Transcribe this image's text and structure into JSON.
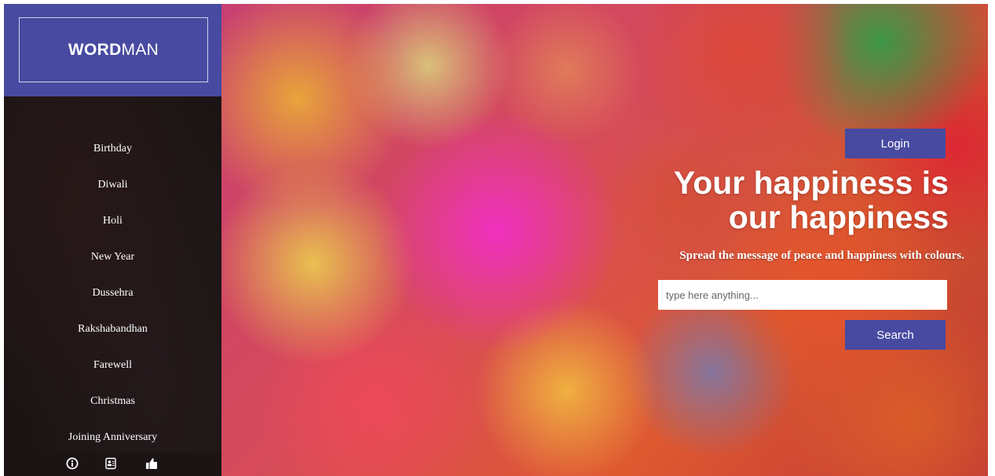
{
  "brand": {
    "bold": "WORD",
    "light": "MAN"
  },
  "nav": {
    "items": [
      {
        "label": "Birthday"
      },
      {
        "label": "Diwali"
      },
      {
        "label": "Holi"
      },
      {
        "label": "New Year"
      },
      {
        "label": "Dussehra"
      },
      {
        "label": "Rakshabandhan"
      },
      {
        "label": "Farewell"
      },
      {
        "label": "Christmas"
      },
      {
        "label": "Joining Anniversary"
      }
    ]
  },
  "footer_icons": [
    "info-icon",
    "contact-card-icon",
    "thumbs-up-icon"
  ],
  "hero": {
    "login_label": "Login",
    "headline_line1": "Your happiness is",
    "headline_line2": "our happiness",
    "tagline": "Spread the message of peace and happiness with colours.",
    "search": {
      "placeholder": "type here anything...",
      "value": ""
    },
    "search_label": "Search"
  },
  "colors": {
    "accent": "#474aa0",
    "sidebar_bg": "#1c1414",
    "text_light": "#ffffff"
  }
}
